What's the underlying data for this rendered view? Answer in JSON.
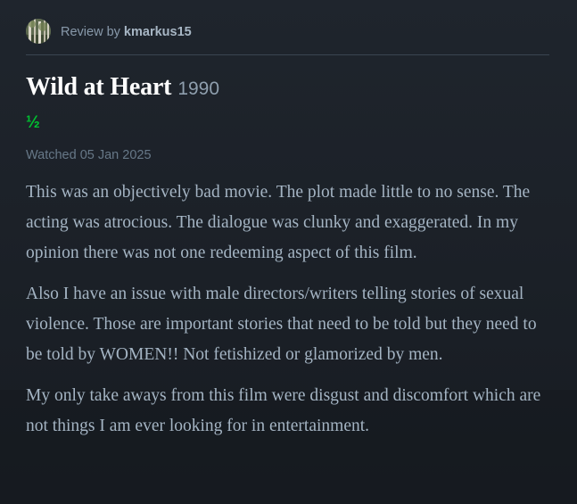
{
  "review_header": {
    "prefix": "Review by ",
    "username": "kmarkus15",
    "avatar_icon": "user-avatar-forest-icon"
  },
  "film": {
    "title": "Wild at Heart",
    "year": "1990"
  },
  "rating": {
    "display": "½",
    "stars": 0.5,
    "color": "#00c030"
  },
  "watched": "Watched 05 Jan 2025",
  "review_body": [
    "This was an objectively bad movie. The plot made little to no sense. The acting was atrocious. The dialogue was clunky and exaggerated. In my opinion there was not one redeeming aspect of this film.",
    "Also I have an issue with male directors/writers telling stories of sexual violence. Those are important stories that need to be told but they need to be told by WOMEN!! Not fetishized or glamorized by men.",
    "My only take aways from this film were disgust and discomfort which are not things I am ever looking for in entertainment."
  ],
  "colors": {
    "background": "#1b2027",
    "title": "#ffffff",
    "body_text": "#a4b4c3",
    "muted_text": "#677888",
    "accent_green": "#00c030"
  }
}
